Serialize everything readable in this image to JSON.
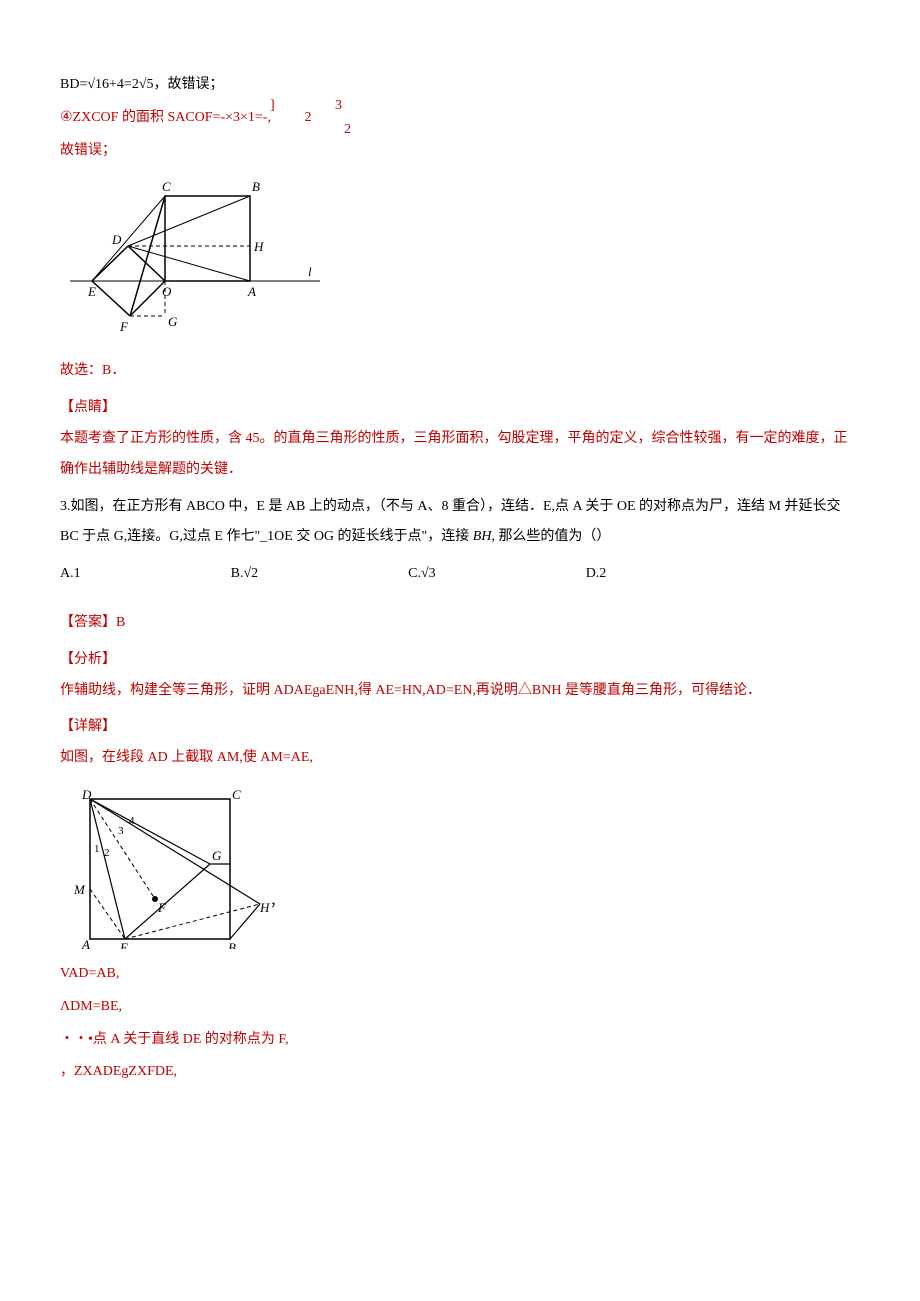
{
  "line1": "BD=√16+4=2√5，故错误；",
  "line2a": "④ZXCOF 的面积 SACOF=-×3×1=-,",
  "line2b_num_top": "]",
  "line2b_num_right": "3",
  "line2c_right": "2",
  "line2d": "2",
  "line3": "故错误；",
  "diagram1_labels": {
    "C": "C",
    "B": "B",
    "D": "D",
    "H": "H",
    "l": "l",
    "E": "E",
    "O": "O",
    "A": "A",
    "F": "F",
    "G": "G"
  },
  "line4": "故选：B．",
  "heading1": "【点睛】",
  "para1": "本题考查了正方形的性质，含 45。的直角三角形的性质，三角形面积，勾股定理，平角的定义，综合性较强，有一定的难度，正确作出辅助线是解题的关键．",
  "q3_a": "3.如图，在正方形有 ABCO 中，E 是 AB 上的动点，（不与 A、8 重合），连结．E,点 A 关于 OE 的对称点为尸，连结 M 并延长交 BC 于点 G,连接。G,过点 E 作七\"_1OE 交 OG 的延长线于点\"，连接 ",
  "q3_b_italic": "BH,",
  "q3_c": " 那么些的值为（）",
  "opt_a": "A.1",
  "opt_b": "B.√2",
  "opt_c": "C.√3",
  "opt_d": "D.2",
  "heading2": "【答案】B",
  "heading3": "【分析】",
  "para2": "作辅助线，构建全等三角形，证明 ADAEgaENH,得 AE=HN,AD=EN,再说明△BNH 是等腰直角三角形，可得结论．",
  "heading4": "【详解】",
  "line5": "如图，在线段 AD 上截取 AM,使 AM=AE,",
  "diagram2_labels": {
    "D": "D",
    "C": "C",
    "3": "3",
    "4": "4",
    "1": "1",
    "2": "2",
    "G": "G",
    "M": "M",
    "F": "F",
    "H": "H",
    "A": "A",
    "E": "E",
    "B": "B"
  },
  "diagram2_trail": "，",
  "line6": "VAD=AB,",
  "line7": "ΛDM=BE,",
  "line8": "・・•点 A 关于直线 DE 的对称点为 F,",
  "line9": "，ZXADEgZXFDE,"
}
